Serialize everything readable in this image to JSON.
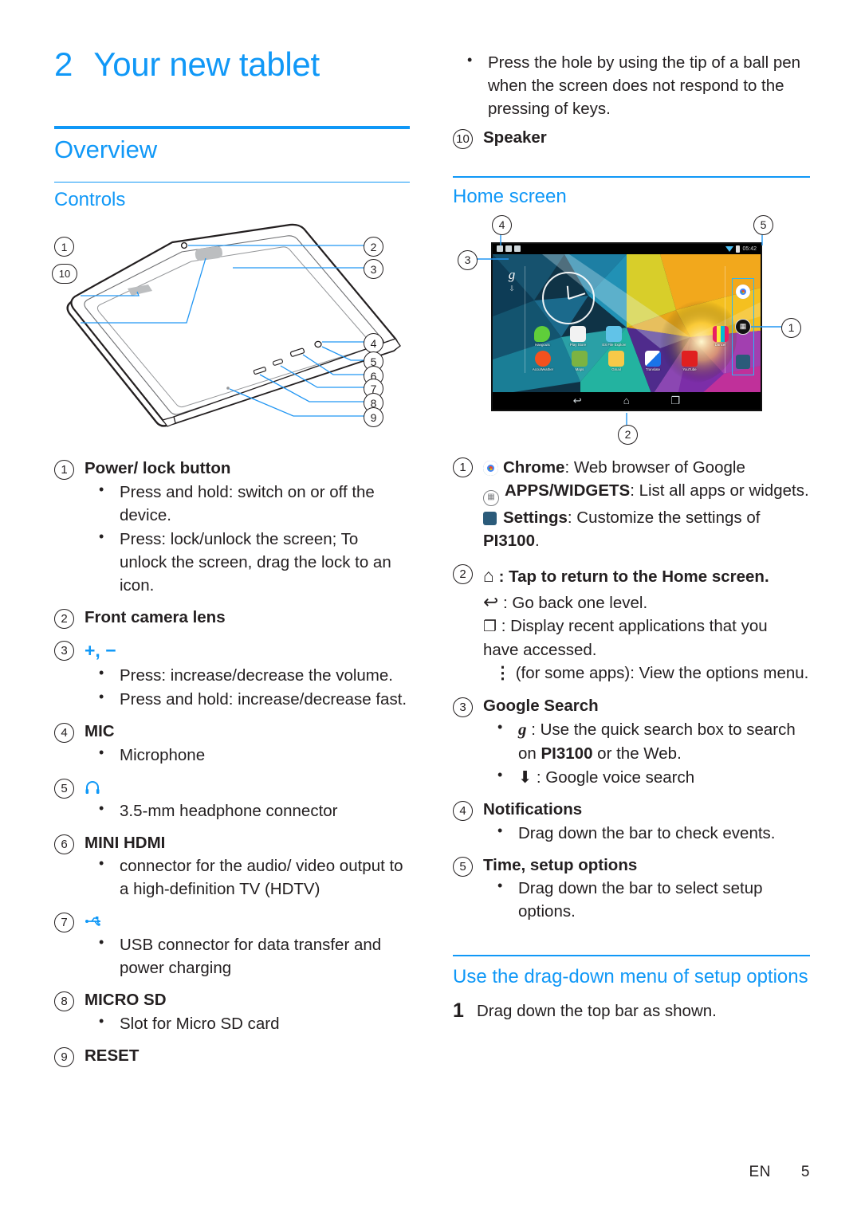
{
  "chapter": {
    "number": "2",
    "title": "Your new tablet"
  },
  "left": {
    "section_heading": "Overview",
    "subsection_heading": "Controls",
    "diagram": {
      "name": "tablet-controls-diagram",
      "callouts": [
        "1",
        "10",
        "2",
        "3",
        "4",
        "5",
        "6",
        "7",
        "8",
        "9"
      ]
    },
    "items": [
      {
        "num": "1",
        "title": "Power/ lock button",
        "bullets": [
          "Press and hold: switch on or off the device.",
          "Press: lock/unlock the screen; To unlock the screen, drag the lock to an icon."
        ]
      },
      {
        "num": "2",
        "title": "Front camera lens",
        "bullets": []
      },
      {
        "num": "3",
        "title": "+, −",
        "title_is_symbol": true,
        "bullets": [
          "Press: increase/decrease the volume.",
          "Press and hold: increase/decrease fast."
        ]
      },
      {
        "num": "4",
        "title": "MIC",
        "bullets": [
          "Microphone"
        ]
      },
      {
        "num": "5",
        "title": "headphone-icon",
        "title_is_symbol": true,
        "bullets": [
          "3.5-mm headphone connector"
        ]
      },
      {
        "num": "6",
        "title": "MINI HDMI",
        "bullets": [
          "connector for the audio/ video output to a high-definition TV (HDTV)"
        ]
      },
      {
        "num": "7",
        "title": "usb-icon",
        "title_is_symbol": true,
        "bullets": [
          "USB connector for data transfer and power charging"
        ]
      },
      {
        "num": "8",
        "title": "MICRO SD",
        "bullets": [
          "Slot for Micro SD card"
        ]
      },
      {
        "num": "9",
        "title": "RESET",
        "bullets": []
      }
    ]
  },
  "right": {
    "reset_bullet": "Press the hole by using the tip of a ball pen when the screen does not respond to the pressing of keys.",
    "speaker_num": "10",
    "speaker_label": "Speaker",
    "home_heading": "Home screen",
    "home_screen_mock": {
      "callouts": [
        "4",
        "5",
        "3",
        "1",
        "2"
      ],
      "status_time": "05:42",
      "search_glyph": "g",
      "apps": [
        {
          "label": "Hangouts",
          "color": "#5fce3a"
        },
        {
          "label": "Play Store",
          "color": "#f2f2f2"
        },
        {
          "label": "ES File Explorer",
          "color": "#61c3e8"
        },
        {
          "label": "Dancer",
          "color": "#e91e63"
        },
        {
          "label": "AccuWeather",
          "color": "#f4511e"
        },
        {
          "label": "Maps",
          "color": "#7cb342"
        },
        {
          "label": "Gmail",
          "color": "#f7c948"
        },
        {
          "label": "Translate",
          "color": "#f1f1f1"
        },
        {
          "label": "YouTube",
          "color": "#e02020"
        }
      ],
      "dock": [
        {
          "name": "chrome-icon",
          "label": "Chrome"
        },
        {
          "name": "apps-grid-icon",
          "label": "APPS/WIDGETS"
        },
        {
          "name": "settings-icon",
          "label": "Settings"
        }
      ],
      "nav": [
        {
          "name": "back-icon",
          "glyph": "↩"
        },
        {
          "name": "home-icon",
          "glyph": "⌂"
        },
        {
          "name": "recents-icon",
          "glyph": "❐"
        }
      ]
    },
    "item1": {
      "num": "1",
      "lines": [
        {
          "icon": "chrome-icon",
          "bold": "Chrome",
          "text": ": Web browser of Google"
        },
        {
          "icon": "apps-grid-icon",
          "bold": "APPS/WIDGETS",
          "text": ": List all apps or widgets."
        },
        {
          "icon": "settings-icon",
          "bold": "Settings",
          "text": ": Customize the settings of"
        }
      ],
      "tail_bold": "PI3100",
      "tail_text": "."
    },
    "item2": {
      "num": "2",
      "lines": [
        {
          "glyph": "⌂",
          "name": "home-icon",
          "text": " : Tap to return to the Home screen.",
          "bold": true
        },
        {
          "glyph": "↩",
          "name": "back-icon",
          "text": " : Go back one level.",
          "bold": false
        },
        {
          "glyph": "❐",
          "name": "recents-icon",
          "text": " : Display recent applications that you",
          "bold": false
        }
      ],
      "cont": "have accessed.",
      "last": {
        "glyph": "⋮",
        "name": "overflow-menu-icon",
        "text": " (for some apps): View the options menu."
      }
    },
    "item3": {
      "num": "3",
      "title": "Google Search",
      "bullets": [
        {
          "glyph": "g",
          "name": "google-g-icon",
          "text": " : Use the quick search box to search on ",
          "bold_mid": "PI3100",
          "text2": " or the Web."
        },
        {
          "glyph": "⬇",
          "name": "microphone-icon",
          "text": " : Google voice search"
        }
      ]
    },
    "item4": {
      "num": "4",
      "title": "Notifications",
      "bullets": [
        "Drag down the bar to check events."
      ]
    },
    "item5": {
      "num": "5",
      "title": "Time, setup options",
      "bullets": [
        "Drag down the bar to select setup options."
      ]
    },
    "dragdown_heading": "Use the drag-down menu of setup options",
    "step1_num": "1",
    "step1_text": "Drag down the top bar as shown."
  },
  "footer": {
    "lang": "EN",
    "page": "5"
  },
  "colors": {
    "accent": "#1098f7",
    "text": "#231f20",
    "leader": "#2196f3"
  }
}
